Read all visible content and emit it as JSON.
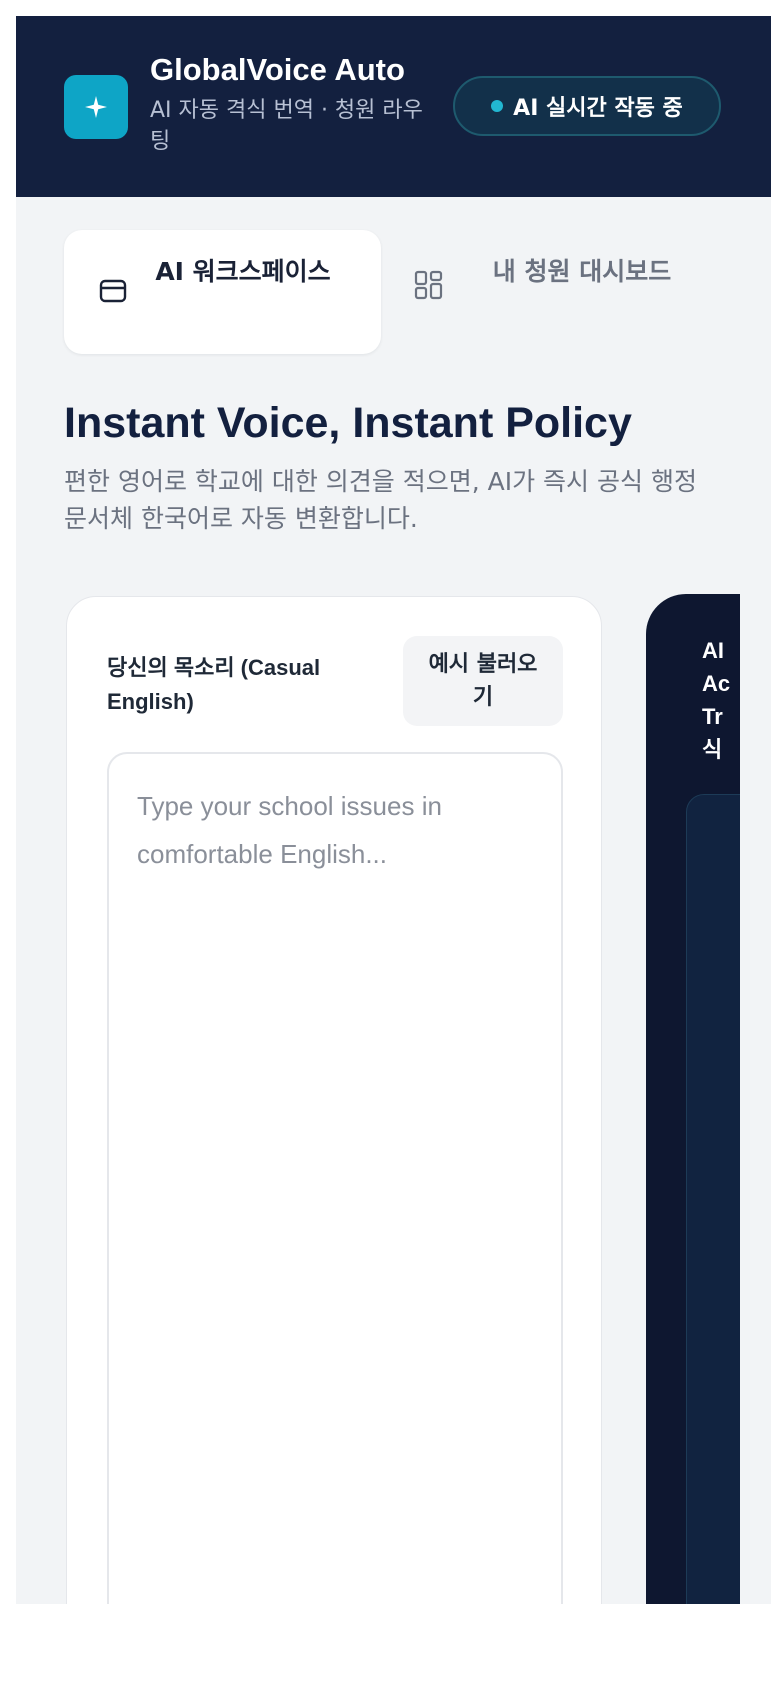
{
  "header": {
    "title": "GlobalVoice Auto",
    "subtitle": "AI 자동 격식 번역 · 청원 라우팅",
    "status": "AI 실시간 작동 중",
    "logo_icon": "sparkle-icon"
  },
  "tabs": [
    {
      "label": "AI 워크스페이스",
      "icon": "card-icon",
      "active": true
    },
    {
      "label": "내 청원 대시보드",
      "icon": "grid-icon",
      "active": false
    }
  ],
  "hero": {
    "title": "Instant Voice, Instant Policy",
    "subtitle": "편한 영어로 학교에 대한 의견을 적으면, AI가 즉시 공식 행정 문서체 한국어로 자동 변환합니다."
  },
  "input_panel": {
    "label": "당신의 목소리 (Casual English)",
    "example_button": "예시 불러오기",
    "textarea_value": "",
    "placeholder": "Type your school issues in comfortable English..."
  },
  "output_panel": {
    "title_visible": "AI Ac Tr 식"
  },
  "colors": {
    "header_bg": "#13203f",
    "accent": "#0ea5c6",
    "page_bg": "#f2f4f6",
    "output_bg": "#0e1730"
  }
}
